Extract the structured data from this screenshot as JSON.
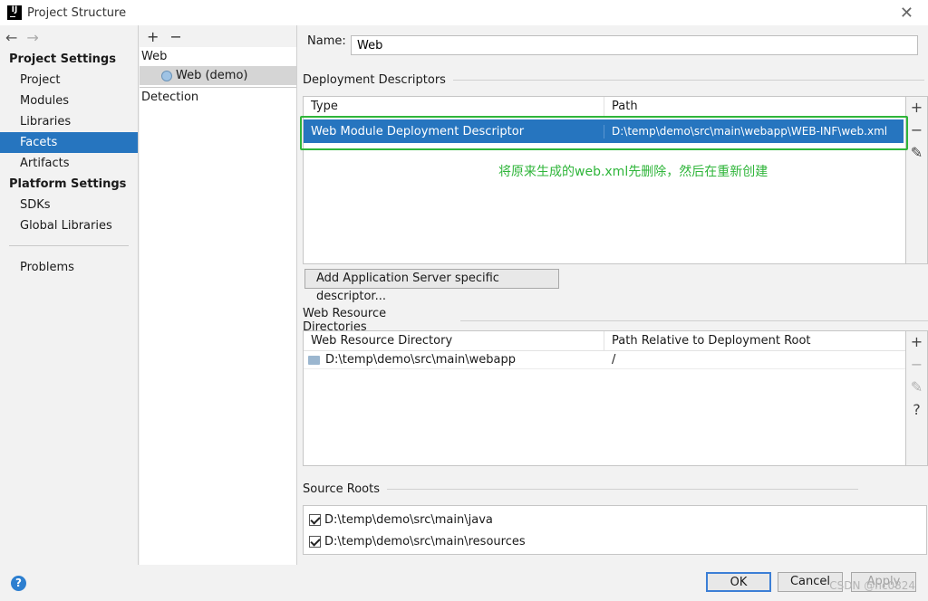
{
  "window": {
    "title": "Project Structure",
    "logo": "IJ",
    "close_icon": "close-icon"
  },
  "sidebar": {
    "project_settings_header": "Project Settings",
    "project_settings_items": [
      {
        "label": "Project"
      },
      {
        "label": "Modules"
      },
      {
        "label": "Libraries"
      },
      {
        "label": "Facets",
        "selected": true
      },
      {
        "label": "Artifacts"
      }
    ],
    "platform_settings_header": "Platform Settings",
    "platform_settings_items": [
      {
        "label": "SDKs"
      },
      {
        "label": "Global Libraries"
      }
    ],
    "problems": "Problems"
  },
  "tree": {
    "add": "+",
    "remove": "−",
    "root": "Web",
    "child": "Web (demo)",
    "detection": "Detection"
  },
  "main": {
    "name_label": "Name:",
    "name_value": "Web",
    "deployment": {
      "title": "Deployment Descriptors",
      "columns": [
        "Type",
        "Path"
      ],
      "row": {
        "type": "Web Module Deployment Descriptor",
        "path": "D:\\temp\\demo\\src\\main\\webapp\\WEB-INF\\web.xml"
      },
      "annotation": "将原来生成的web.xml先删除，然后在重新创建",
      "add_server_button": "Add Application Server specific descriptor..."
    },
    "resources": {
      "title": "Web Resource Directories",
      "columns": [
        "Web Resource Directory",
        "Path Relative to Deployment Root"
      ],
      "row": {
        "dir": "D:\\temp\\demo\\src\\main\\webapp",
        "rel": "/"
      }
    },
    "sources": {
      "title": "Source Roots",
      "items": [
        {
          "path": "D:\\temp\\demo\\src\\main\\java",
          "checked": true
        },
        {
          "path": "D:\\temp\\demo\\src\\main\\resources",
          "checked": true
        }
      ]
    }
  },
  "footer": {
    "help": "?",
    "ok": "OK",
    "cancel": "Cancel",
    "apply": "Apply",
    "watermark": "CSDN @hc0824"
  },
  "colors": {
    "selection": "#2675bf",
    "annotation": "#2fb53a"
  }
}
